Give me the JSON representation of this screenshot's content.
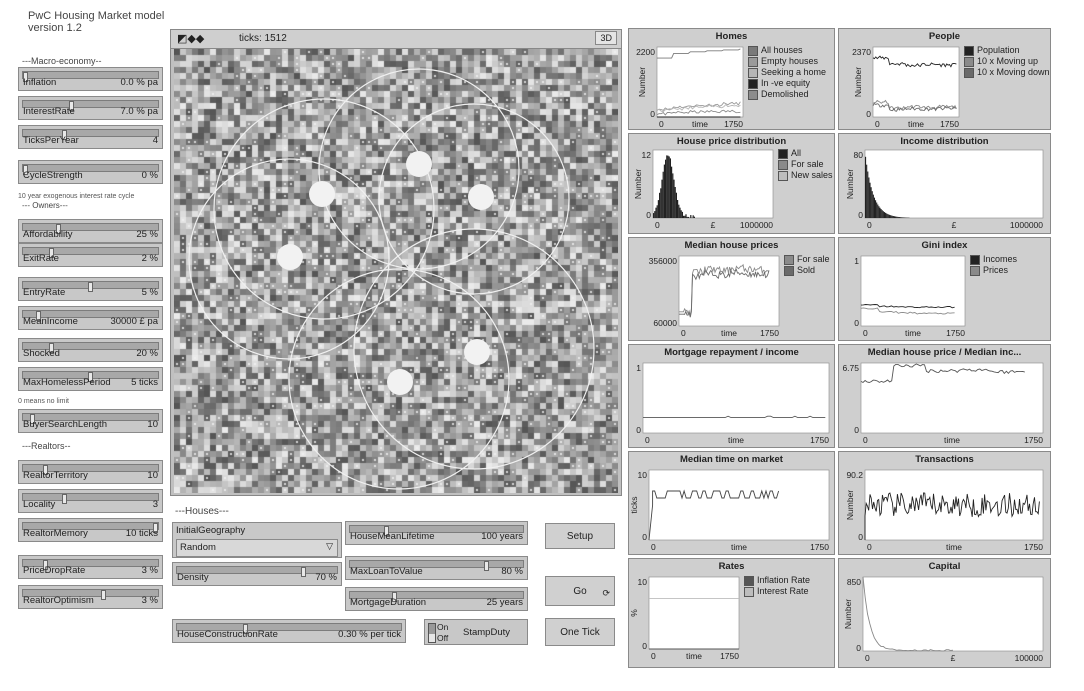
{
  "app": {
    "title_line1": "PwC Housing Market model",
    "title_line2": "version 1.2"
  },
  "sections": {
    "macro": "---Macro-economy--",
    "owners": "--- Owners---",
    "realtors": "---Realtors--",
    "houses": "---Houses---"
  },
  "notes": {
    "cycle": "10 year exogenous interest rate cycle",
    "homeless": "0 means no limit"
  },
  "sliders_left": [
    {
      "name": "Inflation",
      "value": "0.0 % pa",
      "level": 0.0
    },
    {
      "name": "InterestRate",
      "value": "7.0 % pa",
      "level": 0.35
    },
    {
      "name": "TicksPerYear",
      "value": "4",
      "level": 0.3
    },
    {
      "name": "CycleStrength",
      "value": "0 %",
      "level": 0.0
    },
    {
      "name": "Affordability",
      "value": "25 %",
      "level": 0.25
    },
    {
      "name": "ExitRate",
      "value": "2 %",
      "level": 0.2
    },
    {
      "name": "EntryRate",
      "value": "5 %",
      "level": 0.5
    },
    {
      "name": "MeanIncome",
      "value": "30000 £ pa",
      "level": 0.1
    },
    {
      "name": "Shocked",
      "value": "20 %",
      "level": 0.2
    },
    {
      "name": "MaxHomelessPeriod",
      "value": "5 ticks",
      "level": 0.5
    },
    {
      "name": "BuyerSearchLength",
      "value": "10",
      "level": 0.05
    },
    {
      "name": "RealtorTerritory",
      "value": "10",
      "level": 0.15
    },
    {
      "name": "Locality",
      "value": "3",
      "level": 0.3
    },
    {
      "name": "RealtorMemory",
      "value": "10 ticks",
      "level": 1.0
    },
    {
      "name": "PriceDropRate",
      "value": "3 %",
      "level": 0.15
    },
    {
      "name": "RealtorOptimism",
      "value": "3 %",
      "level": 0.6
    }
  ],
  "world": {
    "ticks_label": "ticks: 1512",
    "view3d": "3D"
  },
  "houses_controls": {
    "initial_geography": {
      "label": "InitialGeography",
      "value": "Random"
    },
    "density": {
      "name": "Density",
      "value": "70 %",
      "level": 0.8
    },
    "house_construction": {
      "name": "HouseConstructionRate",
      "value": "0.30 % per tick",
      "level": 0.3
    },
    "lifetime": {
      "name": "HouseMeanLifetime",
      "value": "100 years",
      "level": 0.2
    },
    "ltv": {
      "name": "MaxLoanToValue",
      "value": "80 %",
      "level": 0.8
    },
    "mortgage": {
      "name": "MortgageDuration",
      "value": "25 years",
      "level": 0.25
    },
    "stampduty": {
      "on": "On",
      "off": "Off",
      "label": "StampDuty"
    }
  },
  "buttons": {
    "setup": "Setup",
    "go": "Go",
    "one_tick": "One Tick",
    "go_icon": "forever-icon"
  },
  "plots": [
    {
      "title": "Homes",
      "ylabel": "Number",
      "ymax": "2200",
      "ymin": "0",
      "xmin": "0",
      "xlabel": "time",
      "xmax": "1750",
      "legend": [
        {
          "label": "All houses",
          "color": "#7a7a7a"
        },
        {
          "label": "Empty houses",
          "color": "#9a9a9a"
        },
        {
          "label": "Seeking a home",
          "color": "#b5b5b5"
        },
        {
          "label": "In -ve equity",
          "color": "#222222"
        },
        {
          "label": "Demolished",
          "color": "#8c8c8c"
        }
      ]
    },
    {
      "title": "People",
      "ylabel": "Number",
      "ymax": "2370",
      "ymin": "0",
      "xmin": "0",
      "xlabel": "time",
      "xmax": "1750",
      "legend": [
        {
          "label": "Population",
          "color": "#222222"
        },
        {
          "label": "10 x Moving up",
          "color": "#8a8a8a"
        },
        {
          "label": "10 x Moving down",
          "color": "#6a6a6a"
        }
      ]
    },
    {
      "title": "House price distribution",
      "ylabel": "Number",
      "ymax": "12",
      "ymin": "0",
      "xmin": "0",
      "xlabel": "£",
      "xmax": "1000000",
      "legend": [
        {
          "label": "All",
          "color": "#222222"
        },
        {
          "label": "For sale",
          "color": "#8a8a8a"
        },
        {
          "label": "New sales",
          "color": "#bdbdbd"
        }
      ]
    },
    {
      "title": "Income distribution",
      "ylabel": "Number",
      "ymax": "80",
      "ymin": "0",
      "xmin": "0",
      "xlabel": "£",
      "xmax": "1000000",
      "legend": []
    },
    {
      "title": "Median house prices",
      "ylabel": "",
      "ymax": "356000",
      "ymin": "60000",
      "xmin": "0",
      "xlabel": "time",
      "xmax": "1750",
      "legend": [
        {
          "label": "For sale",
          "color": "#8a8a8a"
        },
        {
          "label": "Sold",
          "color": "#6a6a6a"
        }
      ]
    },
    {
      "title": "Gini index",
      "ylabel": "",
      "ymax": "1",
      "ymin": "0",
      "xmin": "0",
      "xlabel": "time",
      "xmax": "1750",
      "legend": [
        {
          "label": "Incomes",
          "color": "#222222"
        },
        {
          "label": "Prices",
          "color": "#8a8a8a"
        }
      ]
    },
    {
      "title": "Mortgage repayment / income",
      "ylabel": "",
      "ymax": "1",
      "ymin": "0",
      "xmin": "0",
      "xlabel": "time",
      "xmax": "1750",
      "legend": []
    },
    {
      "title": "Median house price / Median inc...",
      "ylabel": "",
      "ymax": "6.75",
      "ymin": "0",
      "xmin": "0",
      "xlabel": "time",
      "xmax": "1750",
      "legend": []
    },
    {
      "title": "Median time on market",
      "ylabel": "ticks",
      "ymax": "10",
      "ymin": "0",
      "xmin": "0",
      "xlabel": "time",
      "xmax": "1750",
      "legend": []
    },
    {
      "title": "Transactions",
      "ylabel": "Number",
      "ymax": "90.2",
      "ymin": "0",
      "xmin": "0",
      "xlabel": "time",
      "xmax": "1750",
      "legend": []
    },
    {
      "title": "Rates",
      "ylabel": "%",
      "ymax": "10",
      "ymin": "0",
      "xmin": "0",
      "xlabel": "time",
      "xmax": "1750",
      "legend": [
        {
          "label": "Inflation Rate",
          "color": "#555555"
        },
        {
          "label": "Interest Rate",
          "color": "#bdbdbd"
        }
      ]
    },
    {
      "title": "Capital",
      "ylabel": "Number",
      "ymax": "850",
      "ymin": "0",
      "xmin": "0",
      "xlabel": "£",
      "xmax": "100000",
      "legend": []
    }
  ],
  "chart_data": [
    {
      "type": "line",
      "title": "Homes",
      "x": [
        0,
        200,
        400,
        800,
        1200,
        1750
      ],
      "series": [
        {
          "name": "All houses",
          "values": [
            1850,
            2000,
            2050,
            2080,
            2110,
            2140
          ]
        },
        {
          "name": "Empty houses",
          "values": [
            250,
            320,
            360,
            380,
            420,
            460
          ]
        },
        {
          "name": "Seeking a home",
          "values": [
            200,
            260,
            300,
            330,
            360,
            380
          ]
        },
        {
          "name": "In -ve equity",
          "values": [
            0,
            0,
            0,
            0,
            0,
            0
          ]
        },
        {
          "name": "Demolished",
          "values": [
            100,
            140,
            160,
            170,
            180,
            190
          ]
        }
      ],
      "xlabel": "time",
      "ylabel": "Number",
      "ylim": [
        0,
        2200
      ]
    },
    {
      "type": "line",
      "title": "People",
      "x": [
        0,
        100,
        400,
        800,
        1200,
        1750
      ],
      "series": [
        {
          "name": "Population",
          "values": [
            2000,
            1800,
            1750,
            1780,
            1760,
            1820
          ]
        },
        {
          "name": "10 x Moving up",
          "values": [
            500,
            300,
            350,
            320,
            340,
            330
          ]
        },
        {
          "name": "10 x Moving down",
          "values": [
            400,
            250,
            280,
            270,
            290,
            300
          ]
        }
      ],
      "xlabel": "time",
      "ylabel": "Number",
      "ylim": [
        0,
        2370
      ]
    },
    {
      "type": "line",
      "title": "Median house prices",
      "x": [
        0,
        100,
        300,
        600,
        900,
        1200,
        1500,
        1750
      ],
      "series": [
        {
          "name": "For sale",
          "values": [
            120000,
            290000,
            300000,
            295000,
            305000,
            300000,
            298000,
            302000
          ]
        },
        {
          "name": "Sold",
          "values": [
            110000,
            270000,
            280000,
            275000,
            285000,
            280000,
            278000,
            282000
          ]
        }
      ],
      "ylim": [
        60000,
        356000
      ]
    },
    {
      "type": "line",
      "title": "Gini index",
      "x": [
        0,
        200,
        600,
        1000,
        1400,
        1750
      ],
      "series": [
        {
          "name": "Incomes",
          "values": [
            0.3,
            0.28,
            0.27,
            0.27,
            0.27,
            0.27
          ]
        },
        {
          "name": "Prices",
          "values": [
            0.25,
            0.2,
            0.19,
            0.18,
            0.18,
            0.18
          ]
        }
      ],
      "ylim": [
        0,
        1
      ]
    },
    {
      "type": "line",
      "title": "Median house price / Median inc...",
      "x": [
        0,
        100,
        400,
        800,
        1200,
        1750
      ],
      "series": [
        {
          "values": [
            5.0,
            6.5,
            6.0,
            6.1,
            5.9,
            6.0
          ]
        }
      ],
      "ylim": [
        0,
        6.75
      ]
    },
    {
      "type": "line",
      "title": "Rates",
      "x": [
        0,
        1750
      ],
      "series": [
        {
          "name": "Inflation Rate",
          "values": [
            0,
            0
          ]
        },
        {
          "name": "Interest Rate",
          "values": [
            7,
            7
          ]
        }
      ],
      "ylim": [
        0,
        10
      ]
    }
  ]
}
